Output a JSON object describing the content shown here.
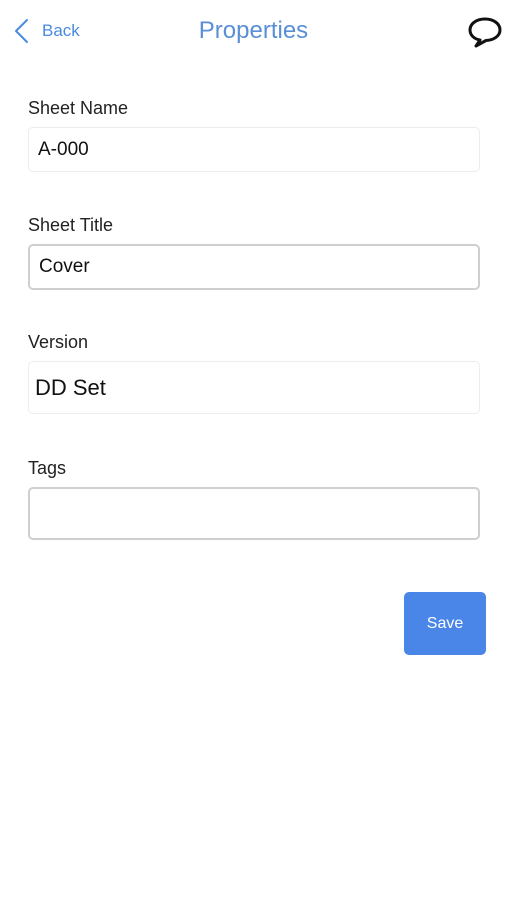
{
  "nav": {
    "back_label": "Back",
    "title": "Properties",
    "back_icon": "chevron-left-icon",
    "comment_icon": "speech-bubble-icon"
  },
  "form": {
    "sheet_name": {
      "label": "Sheet Name",
      "value": "A-000",
      "placeholder": ""
    },
    "sheet_title": {
      "label": "Sheet Title",
      "value": "Cover",
      "placeholder": ""
    },
    "version": {
      "label": "Version",
      "value": "DD Set",
      "placeholder": ""
    },
    "tags": {
      "label": "Tags",
      "value": "",
      "placeholder": ""
    }
  },
  "actions": {
    "save_label": "Save"
  },
  "colors": {
    "accent": "#4a86e8",
    "nav_text": "#5a8fd6"
  }
}
